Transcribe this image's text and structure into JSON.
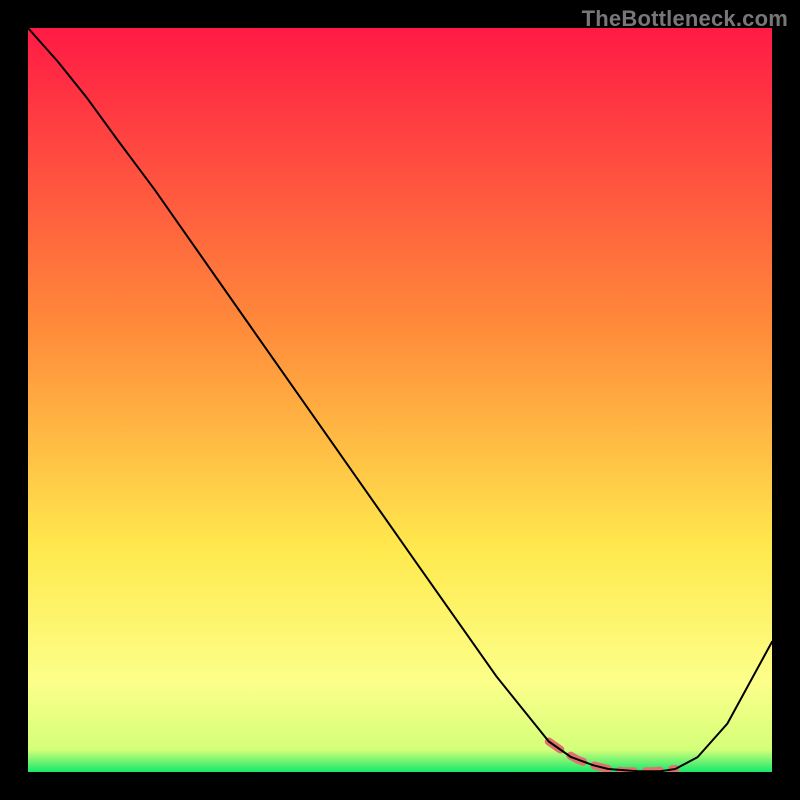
{
  "watermark": "TheBottleneck.com",
  "chart_data": {
    "type": "line",
    "title": "",
    "xlabel": "",
    "ylabel": "",
    "xlim": [
      0,
      1
    ],
    "ylim": [
      0,
      1
    ],
    "gradient_stops": [
      {
        "offset": 0.0,
        "color": "#ff1a45"
      },
      {
        "offset": 0.4,
        "color": "#ff8a3a"
      },
      {
        "offset": 0.7,
        "color": "#ffe94d"
      },
      {
        "offset": 0.88,
        "color": "#fcff8a"
      },
      {
        "offset": 0.97,
        "color": "#d4ff7a"
      },
      {
        "offset": 1.0,
        "color": "#17e86b"
      }
    ],
    "series": [
      {
        "name": "curve",
        "color": "#000000",
        "stroke_width": 2,
        "x": [
          0.0,
          0.04,
          0.08,
          0.12,
          0.17,
          0.28,
          0.4,
          0.52,
          0.63,
          0.7,
          0.73,
          0.76,
          0.78,
          0.82,
          0.85,
          0.87,
          0.9,
          0.94,
          1.0
        ],
        "y": [
          1.0,
          0.955,
          0.905,
          0.85,
          0.783,
          0.626,
          0.455,
          0.284,
          0.128,
          0.041,
          0.02,
          0.009,
          0.004,
          0.001,
          0.001,
          0.004,
          0.02,
          0.065,
          0.175
        ]
      },
      {
        "name": "highlight",
        "color": "#e0716f",
        "stroke_width": 8,
        "dash": [
          14,
          12
        ],
        "x": [
          0.7,
          0.72,
          0.74,
          0.76,
          0.78,
          0.8,
          0.82,
          0.84,
          0.86,
          0.87
        ],
        "y": [
          0.041,
          0.027,
          0.016,
          0.009,
          0.004,
          0.001,
          0.001,
          0.001,
          0.003,
          0.004
        ]
      }
    ]
  }
}
